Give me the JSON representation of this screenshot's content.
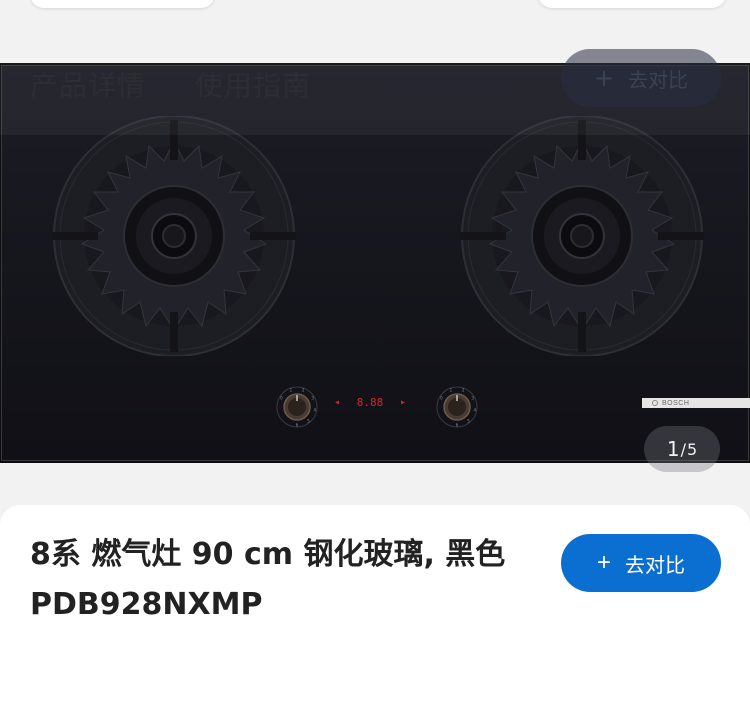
{
  "tabs": [
    {
      "label": "产品详情"
    },
    {
      "label": "使用指南"
    }
  ],
  "compare_button": {
    "plus": "+",
    "label": "去对比"
  },
  "gallery": {
    "current": "1",
    "separator": "/",
    "total": "5",
    "brand": "BOSCH",
    "display_value": "8.88",
    "knob_markings": [
      "0",
      "1",
      "2",
      "3",
      "4",
      "5",
      "6"
    ]
  },
  "product": {
    "title": "8系 燃气灶 90 cm 钢化玻璃, 黑色 PDB928NXMP"
  },
  "colors": {
    "accent": "#0a6fd1",
    "glass": "#15151c",
    "display_red": "#d8262a"
  }
}
